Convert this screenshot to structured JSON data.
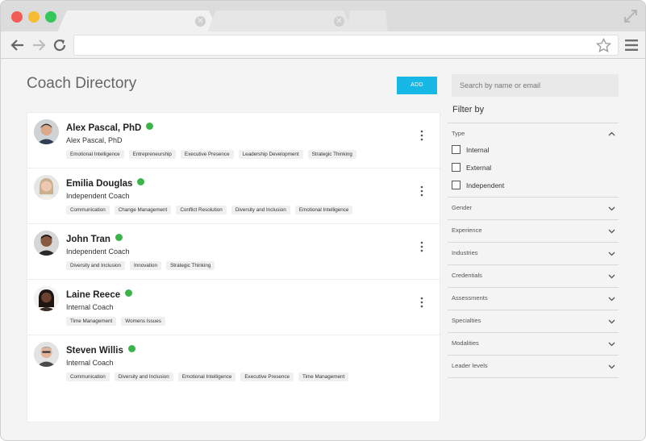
{
  "page": {
    "title": "Coach Directory",
    "add_label": "ADD",
    "search_placeholder": "Search by name or email"
  },
  "colors": {
    "accent": "#17b8e6",
    "online": "#3bb54a"
  },
  "coaches": [
    {
      "name": "Alex Pascal, PhD",
      "subtitle": "Alex Pascal, PhD",
      "online": true,
      "tags": [
        "Emotional Intelligence",
        "Entrepreneurship",
        "Executive Presence",
        "Leadership Development",
        "Strategic Thinking"
      ]
    },
    {
      "name": "Emilia Douglas",
      "subtitle": "Independent Coach",
      "online": true,
      "tags": [
        "Communication",
        "Change Management",
        "Conflict Resolution",
        "Diversity and Inclusion",
        "Emotional Intelligence"
      ]
    },
    {
      "name": "John Tran",
      "subtitle": "Independent Coach",
      "online": true,
      "tags": [
        "Diversity and Inclusion",
        "Innovation",
        "Strategic Thinking"
      ]
    },
    {
      "name": "Laine Reece",
      "subtitle": "Internal Coach",
      "online": true,
      "tags": [
        "Time Management",
        "Womens Issues"
      ]
    },
    {
      "name": "Steven Willis",
      "subtitle": "Internal Coach",
      "online": true,
      "tags": [
        "Communication",
        "Diversity and Inclusion",
        "Emotional Intelligence",
        "Executive Presence",
        "Time Management"
      ]
    }
  ],
  "filters": {
    "title": "Filter by",
    "type": {
      "label": "Type",
      "options": [
        "Internal",
        "External",
        "Independent"
      ]
    },
    "sections": [
      "Gender",
      "Experience",
      "Industries",
      "Credentials",
      "Assessments",
      "Specialties",
      "Modalities",
      "Leader levels"
    ]
  }
}
